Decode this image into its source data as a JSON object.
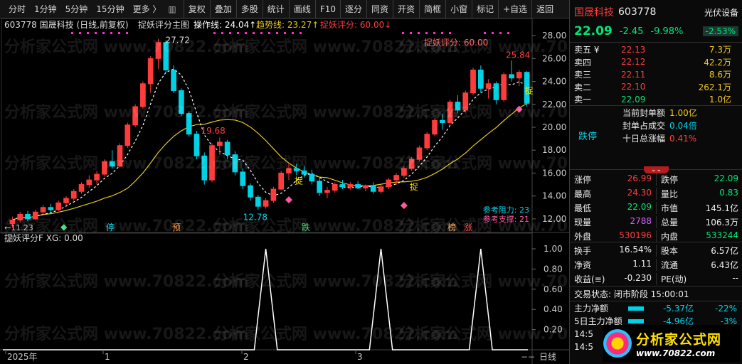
{
  "toolbar": {
    "periods": [
      "分时",
      "1分钟",
      "5分钟",
      "15分钟",
      "更多 〉"
    ],
    "tools": [
      "复权",
      "叠加",
      "多股",
      "统计",
      "画线",
      "F10",
      "逐分",
      "同资",
      "开资",
      "简框",
      "小窗",
      "标记",
      "+自选",
      "返回"
    ]
  },
  "chart": {
    "info_code_line": "603778 国晟科技 (日线,前复权)",
    "info_indicator_name": "捉妖评分主图",
    "info_op_line": "操作线: 24.04↑",
    "info_trend_line": "趋势线: 23.27↑",
    "info_score": "捉妖评分: 60.00↓",
    "score_label": "捉妖评分: 60.00",
    "price_labels": {
      "high": "27.72",
      "mid_high": "19.68",
      "low": "12.78",
      "start": "←11.23",
      "last_high": "25.84"
    },
    "catch_label": "捉",
    "ref_resistance": "参考阻力: 23",
    "ref_support": "参考支撑: 21",
    "bottom_tags": [
      "停",
      "预",
      "跌",
      "榜",
      "涨"
    ],
    "x_axis_labels": [
      "2025年",
      "1",
      "2",
      "3"
    ],
    "period_label": "日线",
    "indicator_title": "捉妖评分F XG: 0.00",
    "y_axis_main": [
      "28.00",
      "26.00",
      "24.00",
      "22.00",
      "20.00",
      "18.00",
      "16.00",
      "14.00",
      "12.00"
    ],
    "y_axis_sub": [
      "1.00",
      "0.80",
      "0.60",
      "0.40",
      "0.20"
    ]
  },
  "watermark": "分析家公式网 www.70822.com",
  "panel": {
    "name": "国晟科技",
    "code": "603778",
    "concept": "光伏设备",
    "price": "22.09",
    "change": "-2.45",
    "change_pct": "-9.98%",
    "concept_pct": "-2.53%",
    "asks": [
      {
        "label": "卖五 ¥",
        "price": "22.13",
        "vol": "7.3万"
      },
      {
        "label": "卖四",
        "price": "22.12",
        "vol": "42.2万"
      },
      {
        "label": "卖三",
        "price": "22.11",
        "vol": "8.6万"
      },
      {
        "label": "卖二",
        "price": "22.10",
        "vol": "262.1万"
      },
      {
        "label": "卖一",
        "price": "22.09",
        "vol": "1.0亿"
      }
    ],
    "seal_items": [
      {
        "label": "当前封单额",
        "value": "1.00亿"
      },
      {
        "label": "封单占成交",
        "value": "0.04倍"
      },
      {
        "label": "十日总涨幅",
        "value": "0.41%"
      }
    ],
    "limit_status": "跌停",
    "stats": [
      {
        "l1": "涨停",
        "v1": "26.99",
        "l2": "跌停",
        "v2": "22.09"
      },
      {
        "l1": "最高",
        "v1": "24.30",
        "l2": "量比",
        "v2": "0.83"
      },
      {
        "l1": "最低",
        "v1": "22.09",
        "l2": "市值",
        "v2": "145.1亿"
      },
      {
        "l1": "现量",
        "v1": "2788",
        "l2": "总量",
        "v2": "106.3万"
      },
      {
        "l1": "外盘",
        "v1": "530196",
        "l2": "内盘",
        "v2": "533244"
      }
    ],
    "stats2": [
      {
        "l1": "换手",
        "v1": "16.54%",
        "l2": "股本",
        "v2": "6.57亿"
      },
      {
        "l1": "净资",
        "v1": "1.11",
        "l2": "流通",
        "v2": "6.43亿"
      },
      {
        "l1": "收益(≡)",
        "v1": "-0.230",
        "l2": "PE(动)",
        "v2": "--"
      }
    ],
    "trade_status": "交易状态: 闭市阶段 15:00:01",
    "flows": [
      {
        "label": "主力净额",
        "value": "-5.37亿",
        "pct": "-22%"
      },
      {
        "label": "5日主力净额",
        "value": "-4.96亿",
        "pct": "-3%"
      }
    ],
    "time_rows": [
      "14:5",
      "14:5"
    ]
  },
  "logo": {
    "title": "分析家公式网",
    "url": "www.70822.com"
  },
  "colors": {
    "up": "#ff3c3c",
    "down": "#00d2e6",
    "ma_yellow": "#e6c619",
    "op_white": "#ffffff"
  },
  "chart_data": {
    "type": "candlestick",
    "candles": [
      [
        11.6,
        12.2,
        11.2,
        11.9
      ],
      [
        11.9,
        12.6,
        11.7,
        12.4
      ],
      [
        12.4,
        12.7,
        11.8,
        12.0
      ],
      [
        12.0,
        12.8,
        11.9,
        12.6
      ],
      [
        12.6,
        13.2,
        12.4,
        13.0
      ],
      [
        13.0,
        13.3,
        12.5,
        12.8
      ],
      [
        12.8,
        13.6,
        12.7,
        13.4
      ],
      [
        13.4,
        14.0,
        13.2,
        13.8
      ],
      [
        13.8,
        14.6,
        13.6,
        14.4
      ],
      [
        14.4,
        15.2,
        14.2,
        15.0
      ],
      [
        15.0,
        15.8,
        14.7,
        15.4
      ],
      [
        15.4,
        16.2,
        15.0,
        15.9
      ],
      [
        15.9,
        17.2,
        15.7,
        17.0
      ],
      [
        17.0,
        18.0,
        16.4,
        16.6
      ],
      [
        16.6,
        18.6,
        16.5,
        18.4
      ],
      [
        18.4,
        20.4,
        18.2,
        20.2
      ],
      [
        20.2,
        22.0,
        20.0,
        21.8
      ],
      [
        21.8,
        24.0,
        21.6,
        23.8
      ],
      [
        23.8,
        26.2,
        23.0,
        26.0
      ],
      [
        26.0,
        27.72,
        25.1,
        27.4
      ],
      [
        27.4,
        27.6,
        24.8,
        25.0
      ],
      [
        25.0,
        25.4,
        23.0,
        23.2
      ],
      [
        23.2,
        23.4,
        21.0,
        21.2
      ],
      [
        21.2,
        21.4,
        19.2,
        19.4
      ],
      [
        19.4,
        19.68,
        17.2,
        17.5
      ],
      [
        17.5,
        17.8,
        15.0,
        15.4
      ],
      [
        15.4,
        18.6,
        15.2,
        18.4
      ],
      [
        18.4,
        19.1,
        17.6,
        18.7
      ],
      [
        18.7,
        18.9,
        17.2,
        17.6
      ],
      [
        17.6,
        17.9,
        15.8,
        16.1
      ],
      [
        16.1,
        16.4,
        14.6,
        14.9
      ],
      [
        14.9,
        15.1,
        13.6,
        13.9
      ],
      [
        13.9,
        14.1,
        12.78,
        13.1
      ],
      [
        13.1,
        13.8,
        12.9,
        13.6
      ],
      [
        13.6,
        14.8,
        13.4,
        14.6
      ],
      [
        14.6,
        16.2,
        14.5,
        16.0
      ],
      [
        16.0,
        16.9,
        15.4,
        16.4
      ],
      [
        16.4,
        16.8,
        15.8,
        16.2
      ],
      [
        16.2,
        16.6,
        15.6,
        15.9
      ],
      [
        15.9,
        16.3,
        15.0,
        15.3
      ],
      [
        15.3,
        15.6,
        14.0,
        14.3
      ],
      [
        14.3,
        14.8,
        13.8,
        14.5
      ],
      [
        14.5,
        15.2,
        14.3,
        15.0
      ],
      [
        15.0,
        15.4,
        14.6,
        14.8
      ],
      [
        14.8,
        15.2,
        14.5,
        15.0
      ],
      [
        15.0,
        15.3,
        14.6,
        14.7
      ],
      [
        14.7,
        15.0,
        14.4,
        14.9
      ],
      [
        14.9,
        15.2,
        14.2,
        14.4
      ],
      [
        14.4,
        15.0,
        14.2,
        14.8
      ],
      [
        14.8,
        15.6,
        14.6,
        15.4
      ],
      [
        15.4,
        16.0,
        15.0,
        15.8
      ],
      [
        15.8,
        16.6,
        15.6,
        16.4
      ],
      [
        16.4,
        17.4,
        16.2,
        17.2
      ],
      [
        17.2,
        18.4,
        17.0,
        18.2
      ],
      [
        18.2,
        19.6,
        18.0,
        19.4
      ],
      [
        19.4,
        20.8,
        19.2,
        20.6
      ],
      [
        20.6,
        21.2,
        19.8,
        20.4
      ],
      [
        20.4,
        22.4,
        20.2,
        22.2
      ],
      [
        22.2,
        22.8,
        21.2,
        21.5
      ],
      [
        21.5,
        23.2,
        21.3,
        23.0
      ],
      [
        23.0,
        25.2,
        22.8,
        25.0
      ],
      [
        25.0,
        25.4,
        23.0,
        23.4
      ],
      [
        23.4,
        24.2,
        22.5,
        23.8
      ],
      [
        23.8,
        24.0,
        22.0,
        22.4
      ],
      [
        22.4,
        24.8,
        22.2,
        24.6
      ],
      [
        24.6,
        25.84,
        24.0,
        24.3
      ],
      [
        24.3,
        25.0,
        23.6,
        24.8
      ],
      [
        24.8,
        24.9,
        21.8,
        22.09
      ]
    ],
    "ylim": [
      11,
      29
    ],
    "score_spikes": [
      33,
      48,
      61
    ],
    "sub_ylim": [
      0,
      1
    ]
  }
}
